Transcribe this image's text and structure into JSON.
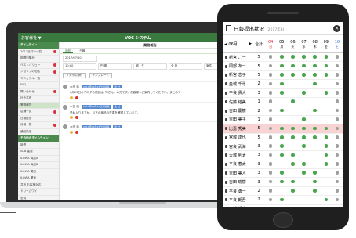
{
  "laptop": {
    "topbar": {
      "org": "お客様社 ▼",
      "system": "VOC システム",
      "user": "▼"
    },
    "sidebar": {
      "items": [
        {
          "label": "タイムライン",
          "head": true
        },
        {
          "label": "2011日付の一覧",
          "badge": true
        },
        {
          "label": "期間別集計"
        },
        {
          "label": "ベストバリュー",
          "badge": true
        },
        {
          "label": "ショップの回答",
          "badge": true
        },
        {
          "label": "マニュアル一覧"
        },
        {
          "label": "FAQ"
        },
        {
          "label": "問い合わせ",
          "badge": true
        },
        {
          "label": "社外共有"
        },
        {
          "label": "業務報告",
          "active": true
        },
        {
          "label": "店舗一覧",
          "badge": true
        },
        {
          "label": "日報提出"
        },
        {
          "label": "月報一覧",
          "badge": true
        },
        {
          "label": "通知設定"
        },
        {
          "label": "その他のタイムライン",
          "head": true
        },
        {
          "label": "新着"
        },
        {
          "label": "SUB 重要"
        },
        {
          "label": "ILOWA 商品A"
        },
        {
          "label": "ILOWA 商品B"
        },
        {
          "label": "ILOWA 関西"
        },
        {
          "label": "ILOWA 関東"
        },
        {
          "label": "共有 お客様対応"
        },
        {
          "label": "ドリームワイ"
        },
        {
          "label": "全員"
        },
        {
          "label": "管理者設定"
        }
      ]
    },
    "main": {
      "page_title": "業務報告",
      "tabs": [
        "通知",
        "日報"
      ],
      "date_value": "2017/07/20",
      "time_value": "10:00",
      "filters": [
        "",
        "円 期",
        "朝・夕",
        "全 社",
        "案件"
      ],
      "buttons": [
        "ファイル添付",
        "テンプレート"
      ],
      "posts": [
        {
          "author": "木田 結",
          "tag1": "2017年06月23日の投稿",
          "tag2": "全 社",
          "text": "6月23日のブログの前回は「Kさん」の方です。お客様へご案内してください。まとめて"
        },
        {
          "author": "木田 結",
          "tag1": "2017年06月23日の投稿",
          "tag2": "全 社",
          "text": "恐れ入りますが、以下の商品の在庫を確認しています。"
        },
        {
          "author": "木田 結",
          "tag1": "2017年06月23日の投稿",
          "tag2": "全 社",
          "text": ""
        }
      ]
    }
  },
  "phone": {
    "header": {
      "title": "日報提出状況",
      "subtitle": "(2017年6)"
    },
    "nav": {
      "prev": "◀ 06月",
      "next": "▶",
      "total_label": "合計"
    },
    "days": [
      {
        "d": "04",
        "w": "日",
        "cls": "red"
      },
      {
        "d": "05",
        "w": "月"
      },
      {
        "d": "06",
        "w": "火"
      },
      {
        "d": "07",
        "w": "水"
      },
      {
        "d": "08",
        "w": "木"
      },
      {
        "d": "09",
        "w": "金"
      },
      {
        "d": "10",
        "w": "土",
        "cls": "blue"
      }
    ],
    "rows": [
      {
        "name": "新宮 ご一",
        "total": "5",
        "marks": [
          "g",
          "d",
          "d",
          "d",
          "d",
          "d",
          "g"
        ]
      },
      {
        "name": "岡部 あー",
        "total": "5",
        "marks": [
          "g",
          "d",
          "d",
          "d",
          "d",
          "d",
          "g"
        ]
      },
      {
        "name": "新宮 恋子",
        "total": "5",
        "marks": [
          "g",
          "d",
          "d",
          "d",
          "d",
          "d",
          "g"
        ]
      },
      {
        "name": "金城 千尋",
        "total": "2",
        "marks": [
          "g",
          "d",
          "e",
          "e",
          "d",
          "e",
          "g"
        ]
      },
      {
        "name": "平良 貴大",
        "total": "3",
        "marks": [
          "g",
          "d",
          "e",
          "d",
          "e",
          "d",
          "g"
        ]
      },
      {
        "name": "佐藤 結美",
        "total": "1",
        "marks": [
          "g",
          "e",
          "d",
          "e",
          "e",
          "e",
          "g"
        ]
      },
      {
        "name": "吉田 慶樹",
        "total": "2",
        "marks": [
          "g",
          "d",
          "e",
          "e",
          "d",
          "e",
          "g"
        ]
      },
      {
        "name": "吉田 美子",
        "total": "1",
        "marks": [
          "g",
          "e",
          "e",
          "d",
          "e",
          "e",
          "g"
        ]
      },
      {
        "name": "比嘉 秀美",
        "total": "5",
        "marks": [
          "g",
          "d",
          "d",
          "d",
          "d",
          "d",
          "g"
        ],
        "hl": true
      },
      {
        "name": "宮城 達也",
        "total": "5",
        "marks": [
          "g",
          "d",
          "d",
          "d",
          "d",
          "d",
          "g"
        ]
      },
      {
        "name": "宮良 武海",
        "total": "3",
        "marks": [
          "g",
          "d",
          "e",
          "d",
          "e",
          "d",
          "g"
        ]
      },
      {
        "name": "大城 利太",
        "total": "3",
        "marks": [
          "g",
          "d",
          "d",
          "e",
          "e",
          "d",
          "g"
        ]
      },
      {
        "name": "平良 春太",
        "total": "3",
        "marks": [
          "g",
          "e",
          "d",
          "d",
          "e",
          "d",
          "g"
        ]
      },
      {
        "name": "吉田 美人",
        "total": "3",
        "marks": [
          "g",
          "d",
          "e",
          "d",
          "d",
          "e",
          "g"
        ]
      },
      {
        "name": "吉田 瑞樹",
        "total": "3",
        "marks": [
          "g",
          "d",
          "d",
          "e",
          "d",
          "e",
          "g"
        ]
      },
      {
        "name": "平良 勇一",
        "total": "2",
        "marks": [
          "g",
          "e",
          "d",
          "e",
          "d",
          "e",
          "g"
        ]
      },
      {
        "name": "平良 朗吾",
        "total": "2",
        "marks": [
          "g",
          "d",
          "e",
          "e",
          "e",
          "d",
          "g"
        ]
      },
      {
        "name": "宮城 朗大",
        "total": "5",
        "marks": [
          "g",
          "d",
          "d",
          "d",
          "d",
          "d",
          "g"
        ]
      }
    ]
  }
}
